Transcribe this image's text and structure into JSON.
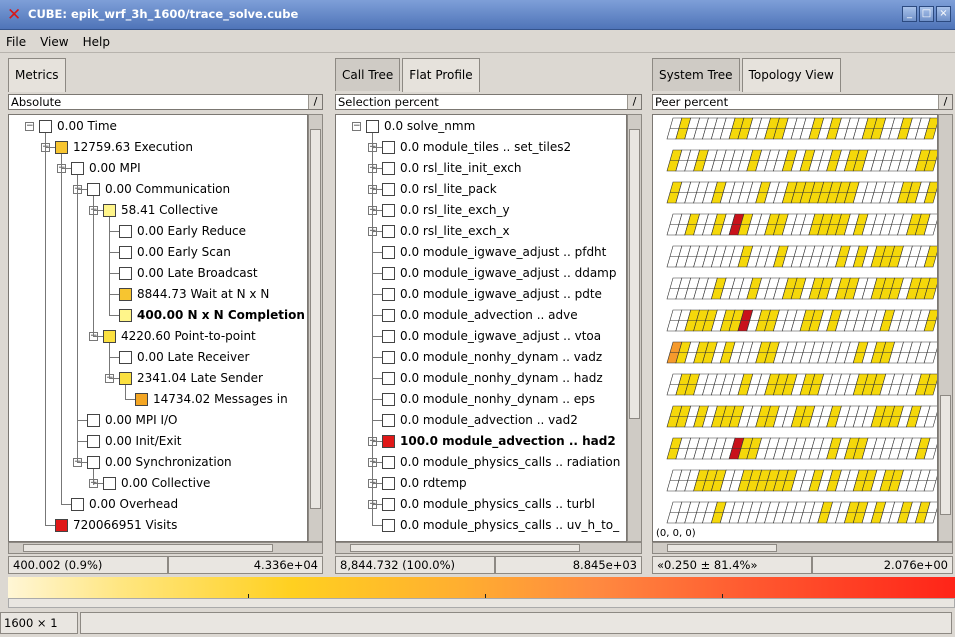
{
  "window": {
    "title": "CUBE: epik_wrf_3h_1600/trace_solve.cube"
  },
  "menu": [
    "File",
    "View",
    "Help"
  ],
  "metrics_pane": {
    "tab": "Metrics",
    "mode": "Absolute",
    "status_left": "400.002  (0.9%)",
    "status_right": "4.336e+04",
    "rows": [
      {
        "label": "0.00 Time",
        "level": 0,
        "toggle": "-",
        "color": "#ffffff"
      },
      {
        "label": "12759.63 Execution",
        "level": 1,
        "toggle": "-",
        "color": "#f7c530"
      },
      {
        "label": "0.00 MPI",
        "level": 2,
        "toggle": "-",
        "color": "#ffffff"
      },
      {
        "label": "0.00 Communication",
        "level": 3,
        "toggle": "-",
        "color": "#ffffff"
      },
      {
        "label": "58.41 Collective",
        "level": 4,
        "toggle": "-",
        "color": "#fff58a"
      },
      {
        "label": "0.00 Early Reduce",
        "level": 5,
        "toggle": "",
        "color": "#ffffff"
      },
      {
        "label": "0.00 Early Scan",
        "level": 5,
        "toggle": "",
        "color": "#ffffff"
      },
      {
        "label": "0.00 Late Broadcast",
        "level": 5,
        "toggle": "",
        "color": "#ffffff"
      },
      {
        "label": "8844.73 Wait at N x N",
        "level": 5,
        "toggle": "",
        "color": "#f7c530"
      },
      {
        "label": "400.00 N x N Completion",
        "level": 5,
        "toggle": "",
        "color": "#fff58a",
        "bold": true
      },
      {
        "label": "4220.60 Point-to-point",
        "level": 4,
        "toggle": "-",
        "color": "#fbe040"
      },
      {
        "label": "0.00 Late Receiver",
        "level": 5,
        "toggle": "",
        "color": "#ffffff"
      },
      {
        "label": "2341.04 Late Sender",
        "level": 5,
        "toggle": "-",
        "color": "#fbe040"
      },
      {
        "label": "14734.02 Messages in",
        "level": 6,
        "toggle": "",
        "color": "#f4a623"
      },
      {
        "label": "0.00 MPI I/O",
        "level": 3,
        "toggle": "",
        "color": "#ffffff"
      },
      {
        "label": "0.00 Init/Exit",
        "level": 3,
        "toggle": "",
        "color": "#ffffff"
      },
      {
        "label": "0.00 Synchronization",
        "level": 3,
        "toggle": "-",
        "color": "#ffffff"
      },
      {
        "label": "0.00 Collective",
        "level": 4,
        "toggle": "+",
        "color": "#ffffff"
      },
      {
        "label": "0.00 Overhead",
        "level": 2,
        "toggle": "",
        "color": "#ffffff"
      },
      {
        "label": "720066951 Visits",
        "level": 1,
        "toggle": "",
        "color": "#e01818"
      }
    ]
  },
  "calltree_pane": {
    "tabs": [
      "Call Tree",
      "Flat Profile"
    ],
    "mode": "Selection percent",
    "status_left": "8,844.732  (100.0%)",
    "status_right": "8.845e+03",
    "rows": [
      {
        "label": "0.0 solve_nmm",
        "level": 0,
        "toggle": "-",
        "color": "#ffffff"
      },
      {
        "label": "0.0 module_tiles .. set_tiles2",
        "level": 1,
        "toggle": "+",
        "color": "#ffffff"
      },
      {
        "label": "0.0 rsl_lite_init_exch",
        "level": 1,
        "toggle": "+",
        "color": "#ffffff"
      },
      {
        "label": "0.0 rsl_lite_pack",
        "level": 1,
        "toggle": "+",
        "color": "#ffffff"
      },
      {
        "label": "0.0 rsl_lite_exch_y",
        "level": 1,
        "toggle": "+",
        "color": "#ffffff"
      },
      {
        "label": "0.0 rsl_lite_exch_x",
        "level": 1,
        "toggle": "+",
        "color": "#ffffff"
      },
      {
        "label": "0.0 module_igwave_adjust .. pfdht",
        "level": 1,
        "toggle": "",
        "color": "#ffffff"
      },
      {
        "label": "0.0 module_igwave_adjust .. ddamp",
        "level": 1,
        "toggle": "",
        "color": "#ffffff"
      },
      {
        "label": "0.0 module_igwave_adjust .. pdte",
        "level": 1,
        "toggle": "",
        "color": "#ffffff"
      },
      {
        "label": "0.0 module_advection .. adve",
        "level": 1,
        "toggle": "",
        "color": "#ffffff"
      },
      {
        "label": "0.0 module_igwave_adjust .. vtoa",
        "level": 1,
        "toggle": "",
        "color": "#ffffff"
      },
      {
        "label": "0.0 module_nonhy_dynam .. vadz",
        "level": 1,
        "toggle": "",
        "color": "#ffffff"
      },
      {
        "label": "0.0 module_nonhy_dynam .. hadz",
        "level": 1,
        "toggle": "",
        "color": "#ffffff"
      },
      {
        "label": "0.0 module_nonhy_dynam .. eps",
        "level": 1,
        "toggle": "",
        "color": "#ffffff"
      },
      {
        "label": "0.0 module_advection .. vad2",
        "level": 1,
        "toggle": "",
        "color": "#ffffff"
      },
      {
        "label": "100.0 module_advection .. had2",
        "level": 1,
        "toggle": "+",
        "color": "#e01818",
        "bold": true
      },
      {
        "label": "0.0 module_physics_calls .. radiation",
        "level": 1,
        "toggle": "+",
        "color": "#ffffff"
      },
      {
        "label": "0.0 rdtemp",
        "level": 1,
        "toggle": "+",
        "color": "#ffffff"
      },
      {
        "label": "0.0 module_physics_calls .. turbl",
        "level": 1,
        "toggle": "+",
        "color": "#ffffff"
      },
      {
        "label": "0.0 module_physics_calls .. uv_h_to_",
        "level": 1,
        "toggle": "",
        "color": "#ffffff"
      }
    ]
  },
  "system_pane": {
    "tabs": [
      "System Tree",
      "Topology View"
    ],
    "mode": "Peer percent",
    "coord": "(0, 0, 0)",
    "status_left": "«0.250 ± 81.4%»",
    "status_right": "2.076e+00"
  },
  "colors": {
    "accent": "#4f74b8",
    "severity_high": "#e01818",
    "severity_mid": "#f7c530",
    "severity_low": "#fff58a"
  },
  "footer": {
    "dims": "1600 × 1"
  }
}
